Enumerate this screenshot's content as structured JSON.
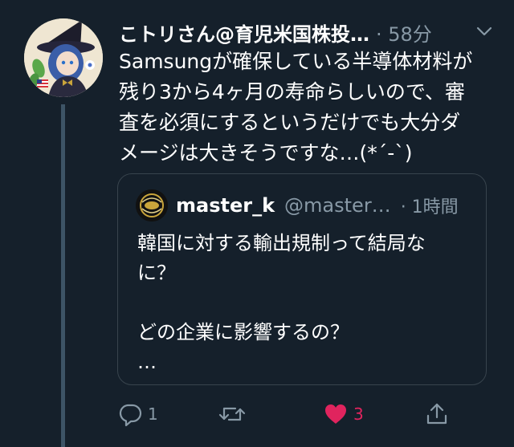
{
  "tweet": {
    "display_name": "こトリさん@育児米国株投…",
    "time": "· 58分",
    "text": "Samsungが確保している半導体材料が\n残り3から4ヶ月の寿命らしいので、審\n査を必須にするというだけでも大分ダ\nメージは大きそうですな…(*´-`)"
  },
  "quoted_tweet": {
    "display_name": "master_k",
    "handle": "@master…",
    "time": "· 1時間",
    "text": "韓国に対する輸出規制って結局な\nに？\n\nどの企業に影響するの？\n…"
  },
  "actions": {
    "reply_count": "1",
    "retweet_count": "",
    "like_count": "3",
    "liked": true
  },
  "icons": {
    "reply": "reply-icon",
    "retweet": "retweet-icon",
    "like": "heart-icon",
    "share": "share-icon",
    "menu": "chevron-down-icon"
  },
  "colors": {
    "background": "#15202b",
    "secondary_text": "#8899a6",
    "like_active": "#e0245e",
    "border": "#38444d",
    "thread_line": "#3d5466"
  }
}
